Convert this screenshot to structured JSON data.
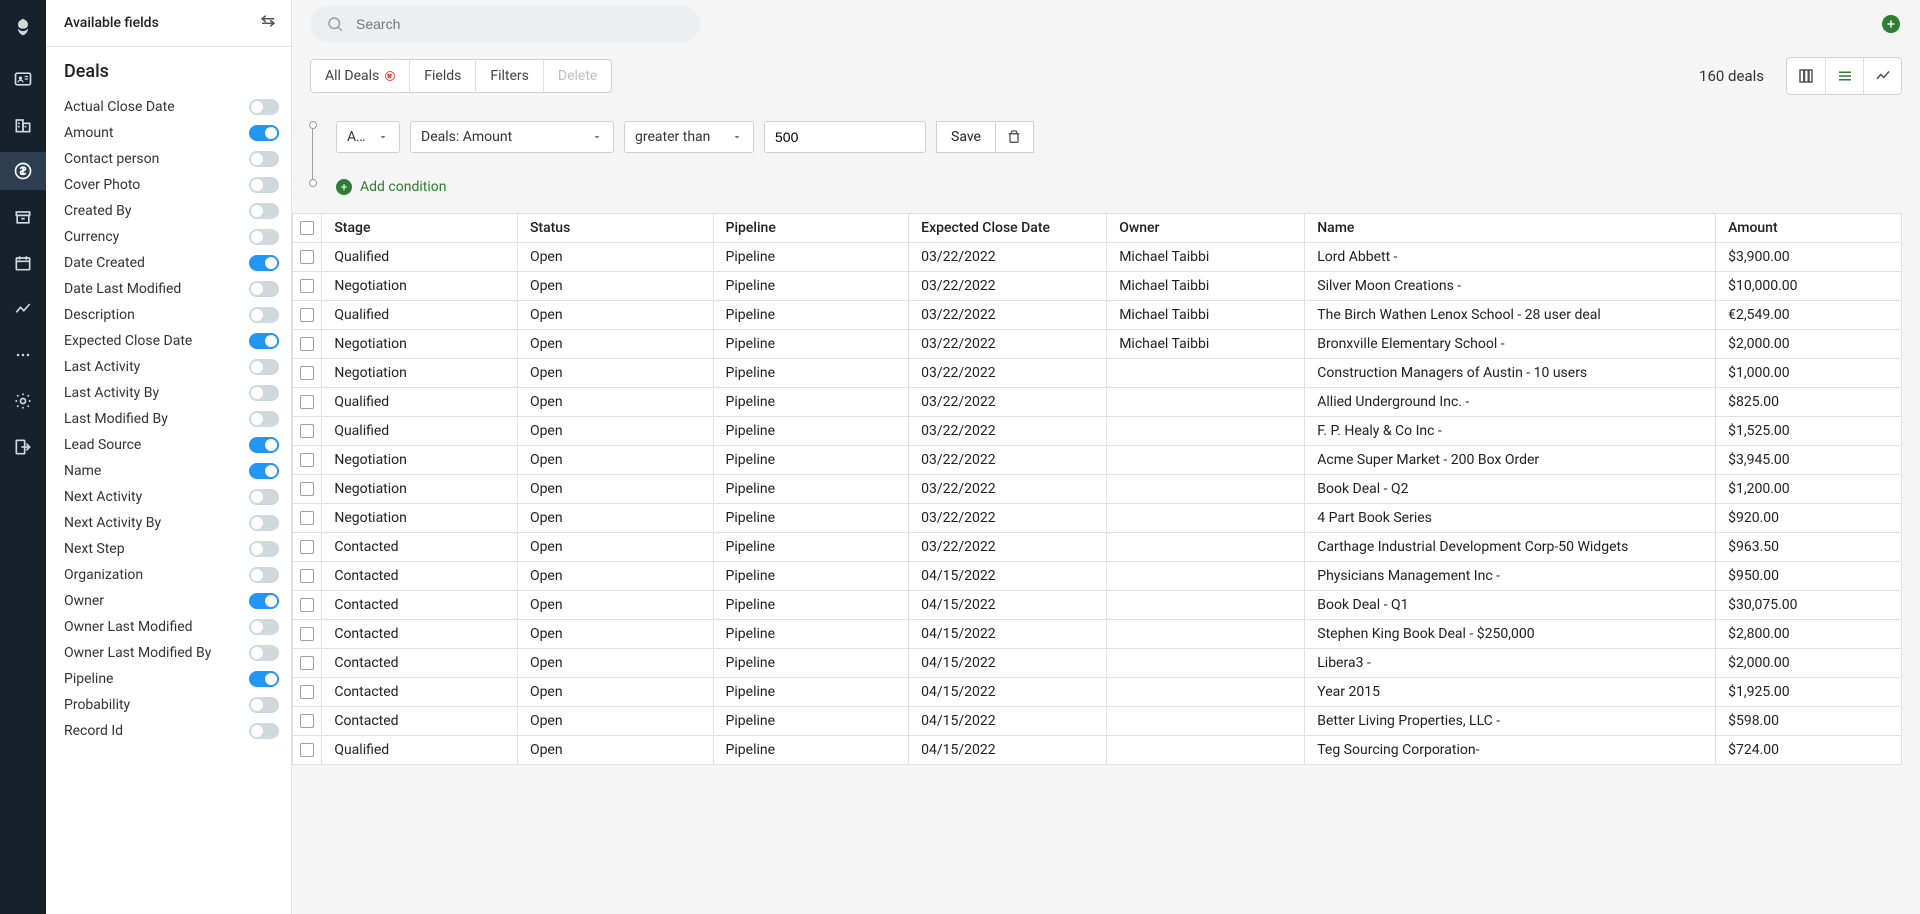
{
  "sidebar": {
    "header": "Available fields",
    "section_title": "Deals",
    "fields": [
      {
        "label": "Actual Close Date",
        "on": false
      },
      {
        "label": "Amount",
        "on": true
      },
      {
        "label": "Contact person",
        "on": false
      },
      {
        "label": "Cover Photo",
        "on": false
      },
      {
        "label": "Created By",
        "on": false
      },
      {
        "label": "Currency",
        "on": false
      },
      {
        "label": "Date Created",
        "on": true
      },
      {
        "label": "Date Last Modified",
        "on": false
      },
      {
        "label": "Description",
        "on": false
      },
      {
        "label": "Expected Close Date",
        "on": true
      },
      {
        "label": "Last Activity",
        "on": false
      },
      {
        "label": "Last Activity By",
        "on": false
      },
      {
        "label": "Last Modified By",
        "on": false
      },
      {
        "label": "Lead Source",
        "on": true
      },
      {
        "label": "Name",
        "on": true
      },
      {
        "label": "Next Activity",
        "on": false
      },
      {
        "label": "Next Activity By",
        "on": false
      },
      {
        "label": "Next Step",
        "on": false
      },
      {
        "label": "Organization",
        "on": false
      },
      {
        "label": "Owner",
        "on": true
      },
      {
        "label": "Owner Last Modified",
        "on": false
      },
      {
        "label": "Owner Last Modified By",
        "on": false
      },
      {
        "label": "Pipeline",
        "on": true
      },
      {
        "label": "Probability",
        "on": false
      },
      {
        "label": "Record Id",
        "on": false
      }
    ]
  },
  "search": {
    "placeholder": "Search"
  },
  "chips": {
    "all_deals": "All Deals",
    "fields": "Fields",
    "filters": "Filters",
    "delete": "Delete"
  },
  "deal_count": "160 deals",
  "filter": {
    "logic": "A…",
    "field": "Deals: Amount",
    "op": "greater than",
    "value": "500",
    "save": "Save",
    "add_condition": "Add condition"
  },
  "columns": [
    "Stage",
    "Status",
    "Pipeline",
    "Expected Close Date",
    "Owner",
    "Name",
    "Amount"
  ],
  "rows": [
    {
      "stage": "Qualified",
      "status": "Open",
      "pipeline": "Pipeline",
      "ecd": "03/22/2022",
      "owner": "Michael Taibbi",
      "name": "Lord Abbett -",
      "amount": "$3,900.00"
    },
    {
      "stage": "Negotiation",
      "status": "Open",
      "pipeline": "Pipeline",
      "ecd": "03/22/2022",
      "owner": "Michael Taibbi",
      "name": "Silver Moon Creations -",
      "amount": "$10,000.00"
    },
    {
      "stage": "Qualified",
      "status": "Open",
      "pipeline": "Pipeline",
      "ecd": "03/22/2022",
      "owner": "Michael Taibbi",
      "name": "The Birch Wathen Lenox School - 28 user deal",
      "amount": "€2,549.00"
    },
    {
      "stage": "Negotiation",
      "status": "Open",
      "pipeline": "Pipeline",
      "ecd": "03/22/2022",
      "owner": "Michael Taibbi",
      "name": "Bronxville Elementary School -",
      "amount": "$2,000.00"
    },
    {
      "stage": "Negotiation",
      "status": "Open",
      "pipeline": "Pipeline",
      "ecd": "03/22/2022",
      "owner": "",
      "name": "Construction Managers of Austin - 10 users",
      "amount": "$1,000.00"
    },
    {
      "stage": "Qualified",
      "status": "Open",
      "pipeline": "Pipeline",
      "ecd": "03/22/2022",
      "owner": "",
      "name": "Allied Underground Inc. -",
      "amount": "$825.00"
    },
    {
      "stage": "Qualified",
      "status": "Open",
      "pipeline": "Pipeline",
      "ecd": "03/22/2022",
      "owner": "",
      "name": "F. P. Healy & Co Inc -",
      "amount": "$1,525.00"
    },
    {
      "stage": "Negotiation",
      "status": "Open",
      "pipeline": "Pipeline",
      "ecd": "03/22/2022",
      "owner": "",
      "name": "Acme Super Market - 200 Box Order",
      "amount": "$3,945.00"
    },
    {
      "stage": "Negotiation",
      "status": "Open",
      "pipeline": "Pipeline",
      "ecd": "03/22/2022",
      "owner": "",
      "name": "Book Deal - Q2",
      "amount": "$1,200.00"
    },
    {
      "stage": "Negotiation",
      "status": "Open",
      "pipeline": "Pipeline",
      "ecd": "03/22/2022",
      "owner": "",
      "name": "4 Part Book Series",
      "amount": "$920.00"
    },
    {
      "stage": "Contacted",
      "status": "Open",
      "pipeline": "Pipeline",
      "ecd": "03/22/2022",
      "owner": "",
      "name": "Carthage Industrial Development Corp-50 Widgets",
      "amount": "$963.50"
    },
    {
      "stage": "Contacted",
      "status": "Open",
      "pipeline": "Pipeline",
      "ecd": "04/15/2022",
      "owner": "",
      "name": "Physicians Management Inc -",
      "amount": "$950.00"
    },
    {
      "stage": "Contacted",
      "status": "Open",
      "pipeline": "Pipeline",
      "ecd": "04/15/2022",
      "owner": "",
      "name": "Book Deal - Q1",
      "amount": "$30,075.00"
    },
    {
      "stage": "Contacted",
      "status": "Open",
      "pipeline": "Pipeline",
      "ecd": "04/15/2022",
      "owner": "",
      "name": "Stephen King Book Deal - $250,000",
      "amount": "$2,800.00"
    },
    {
      "stage": "Contacted",
      "status": "Open",
      "pipeline": "Pipeline",
      "ecd": "04/15/2022",
      "owner": "",
      "name": "Libera3 -",
      "amount": "$2,000.00"
    },
    {
      "stage": "Contacted",
      "status": "Open",
      "pipeline": "Pipeline",
      "ecd": "04/15/2022",
      "owner": "",
      "name": "Year 2015",
      "amount": "$1,925.00"
    },
    {
      "stage": "Contacted",
      "status": "Open",
      "pipeline": "Pipeline",
      "ecd": "04/15/2022",
      "owner": "",
      "name": "Better Living Properties, LLC -",
      "amount": "$598.00"
    },
    {
      "stage": "Qualified",
      "status": "Open",
      "pipeline": "Pipeline",
      "ecd": "04/15/2022",
      "owner": "",
      "name": "Teg Sourcing Corporation-",
      "amount": "$724.00"
    }
  ]
}
